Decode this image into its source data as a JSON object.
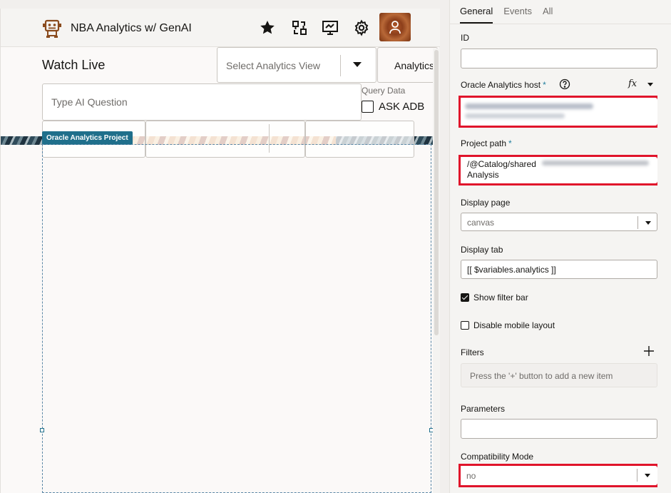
{
  "app": {
    "title": "NBA Analytics w/ GenAI",
    "header_icons": [
      "robot-logo-icon",
      "star-icon",
      "diagram-icon",
      "presentation-icon",
      "gear-icon",
      "user-avatar-icon"
    ]
  },
  "main": {
    "heading": "Watch Live",
    "analytics_view_select": {
      "placeholder": "Select Analytics View"
    },
    "analytics_button_label": "Analytics",
    "ai_question": {
      "placeholder": "Type AI Question",
      "value": ""
    },
    "query_data_label": "Query Data",
    "ask_adb_label": "ASK ADB",
    "ask_adb_checked": false,
    "component_badge": "Oracle Analytics Project"
  },
  "panel": {
    "tabs": [
      {
        "label": "General",
        "active": true
      },
      {
        "label": "Events",
        "active": false
      },
      {
        "label": "All",
        "active": false
      }
    ],
    "id_label": "ID",
    "id_value": "",
    "host_label": "Oracle Analytics host",
    "host_required": "*",
    "help_icon": "question-circle-icon",
    "fx_label": "fx",
    "project_path_label": "Project path",
    "project_path_required": "*",
    "project_path_line1": "/@Catalog/shared",
    "project_path_line2": "Analysis",
    "display_page_label": "Display page",
    "display_page_value": "canvas",
    "display_tab_label": "Display tab",
    "display_tab_value": "[[ $variables.analytics ]]",
    "show_filter_bar_label": "Show filter bar",
    "show_filter_bar_checked": true,
    "disable_mobile_label": "Disable mobile layout",
    "disable_mobile_checked": false,
    "filters_label": "Filters",
    "filters_empty": "Press the '+' button to add a new item",
    "parameters_label": "Parameters",
    "parameters_value": "",
    "compat_label": "Compatibility Mode",
    "compat_value": "no"
  },
  "colors": {
    "highlight": "#e0142b",
    "badge": "#1f6f8b",
    "required": "#227e9e"
  }
}
